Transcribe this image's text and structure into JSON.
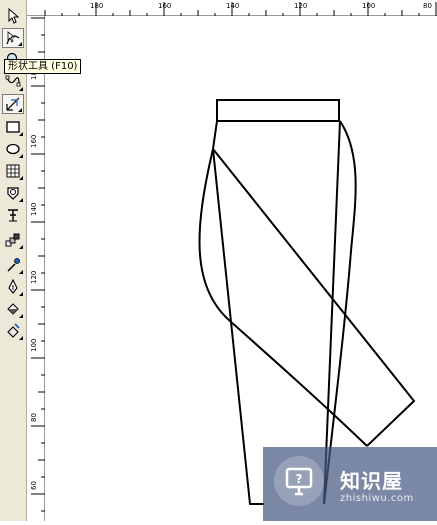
{
  "tooltip": {
    "text": "形状工具 (F10)"
  },
  "ruler_top": {
    "labels": [
      "180",
      "160",
      "140",
      "120",
      "100",
      "80"
    ]
  },
  "ruler_left": {
    "labels": [
      "200",
      "180",
      "160",
      "140",
      "120",
      "100",
      "80",
      "60"
    ]
  },
  "toolbox": {
    "tools": [
      {
        "icon": "pick-arrow-icon",
        "active": false,
        "flyout": false
      },
      {
        "icon": "shape-tool-icon",
        "active": true,
        "flyout": true
      },
      {
        "icon": "zoom-icon",
        "active": false,
        "flyout": true
      },
      {
        "icon": "freehand-icon",
        "active": false,
        "flyout": true
      },
      {
        "icon": "smart-fill-icon",
        "active": true,
        "flyout": true
      },
      {
        "icon": "rectangle-icon",
        "active": false,
        "flyout": true
      },
      {
        "icon": "ellipse-icon",
        "active": false,
        "flyout": true
      },
      {
        "icon": "table-icon",
        "active": false,
        "flyout": true
      },
      {
        "icon": "basic-shapes-icon",
        "active": false,
        "flyout": true
      },
      {
        "icon": "text-icon",
        "active": false,
        "flyout": false
      },
      {
        "icon": "interactive-blend-icon",
        "active": false,
        "flyout": true
      },
      {
        "icon": "eyedropper-icon",
        "active": false,
        "flyout": true
      },
      {
        "icon": "outline-pen-icon",
        "active": false,
        "flyout": true
      },
      {
        "icon": "fill-bucket-icon",
        "active": false,
        "flyout": true
      },
      {
        "icon": "interactive-fill-icon",
        "active": false,
        "flyout": true
      }
    ]
  },
  "watermark": {
    "title": "知识屋",
    "subtitle": "zhishiwu.com"
  },
  "colors": {
    "toolbox_bg": "#ece9d8",
    "tooltip_bg": "#ffffe1",
    "canvas": "#ffffff",
    "outline": "#000000"
  }
}
